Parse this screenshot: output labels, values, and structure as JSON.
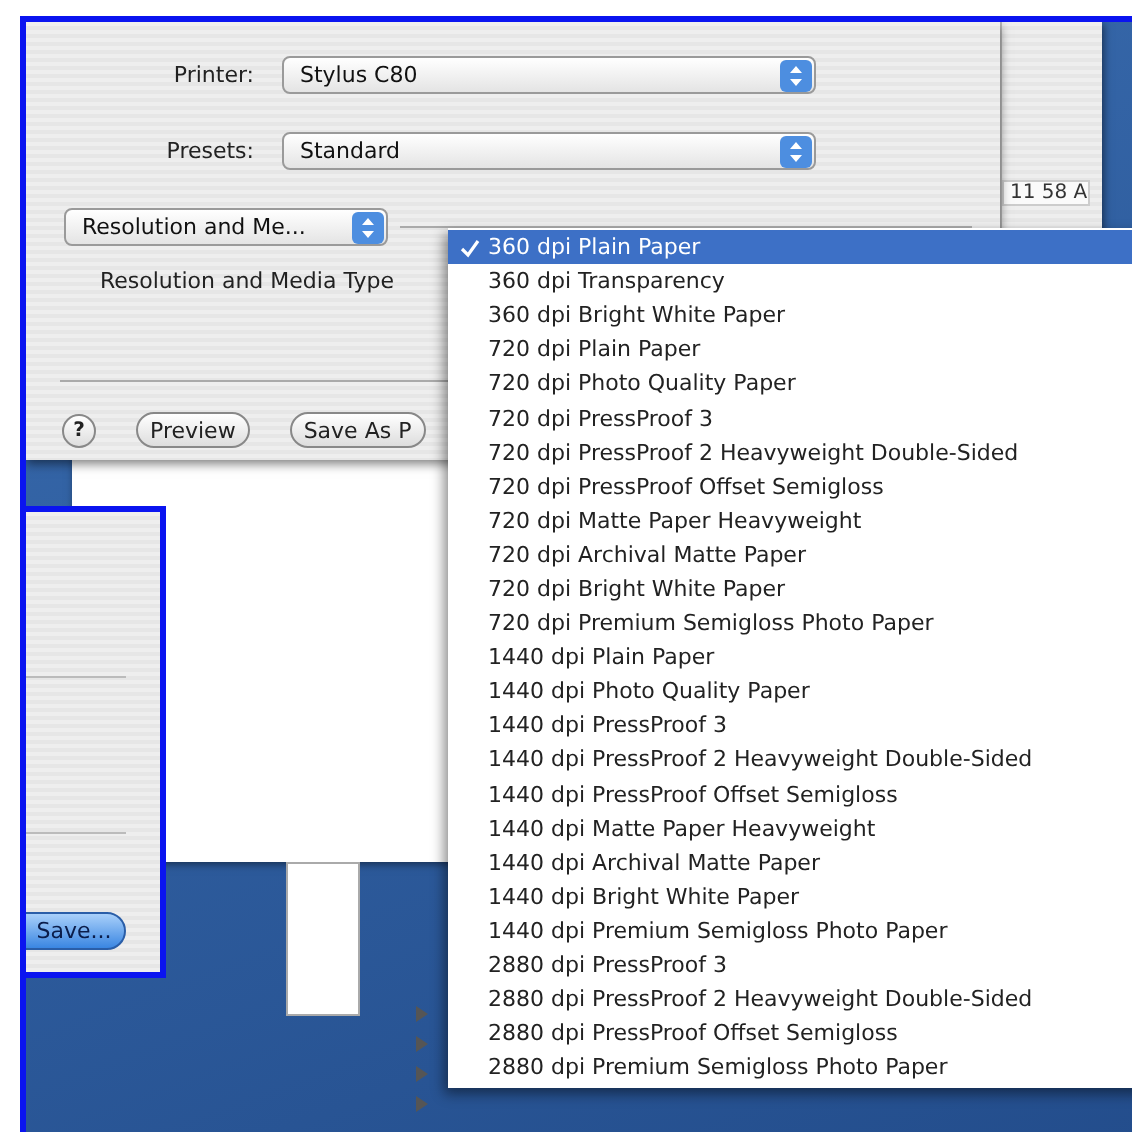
{
  "dialog": {
    "rows": [
      {
        "label": "Printer:",
        "value": "Stylus C80"
      },
      {
        "label": "Presets:",
        "value": "Standard"
      }
    ],
    "panel_popup": "Resolution and Me...",
    "field_label": "Resolution and Media Type",
    "buttons": [
      {
        "kind": "help",
        "label": "?"
      },
      {
        "kind": "normal",
        "label": "Preview"
      },
      {
        "kind": "normal",
        "label": "Save As P"
      }
    ]
  },
  "background_window": {
    "clock_text": "11 58 A"
  },
  "menu": {
    "items": [
      {
        "label": "360 dpi Plain Paper",
        "selected": true,
        "checked": true
      },
      {
        "label": "360 dpi Transparency",
        "selected": false,
        "checked": false
      },
      {
        "label": "360 dpi Bright White Paper",
        "selected": false,
        "checked": false
      },
      {
        "label": "720 dpi Plain Paper",
        "selected": false,
        "checked": false
      },
      {
        "label": "720 dpi Photo Quality Paper",
        "selected": false,
        "checked": false
      },
      {
        "label": "720 dpi PressProof 3",
        "selected": false,
        "checked": false
      },
      {
        "label": "720 dpi PressProof 2 Heavyweight Double-Sided",
        "selected": false,
        "checked": false
      },
      {
        "label": "720 dpi PressProof Offset Semigloss",
        "selected": false,
        "checked": false
      },
      {
        "label": "720 dpi Matte Paper Heavyweight",
        "selected": false,
        "checked": false
      },
      {
        "label": "720 dpi Archival Matte Paper",
        "selected": false,
        "checked": false
      },
      {
        "label": "720 dpi Bright White Paper",
        "selected": false,
        "checked": false
      },
      {
        "label": "720 dpi Premium Semigloss Photo Paper",
        "selected": false,
        "checked": false
      },
      {
        "label": "1440 dpi Plain Paper",
        "selected": false,
        "checked": false
      },
      {
        "label": "1440 dpi Photo Quality Paper",
        "selected": false,
        "checked": false
      },
      {
        "label": "1440 dpi PressProof 3",
        "selected": false,
        "checked": false
      },
      {
        "label": "1440 dpi PressProof 2 Heavyweight Double-Sided",
        "selected": false,
        "checked": false
      },
      {
        "label": "1440 dpi PressProof Offset Semigloss",
        "selected": false,
        "checked": false
      },
      {
        "label": "1440 dpi Matte Paper Heavyweight",
        "selected": false,
        "checked": false
      },
      {
        "label": "1440 dpi Archival Matte Paper",
        "selected": false,
        "checked": false
      },
      {
        "label": "1440 dpi Bright White Paper",
        "selected": false,
        "checked": false
      },
      {
        "label": "1440 dpi Premium Semigloss Photo Paper",
        "selected": false,
        "checked": false
      },
      {
        "label": "2880 dpi PressProof 3",
        "selected": false,
        "checked": false
      },
      {
        "label": "2880 dpi PressProof 2 Heavyweight Double-Sided",
        "selected": false,
        "checked": false
      },
      {
        "label": "2880 dpi PressProof Offset Semigloss",
        "selected": false,
        "checked": false
      },
      {
        "label": "2880 dpi Premium Semigloss Photo Paper",
        "selected": false,
        "checked": false
      }
    ]
  },
  "save_panel": {
    "button": "Save..."
  }
}
